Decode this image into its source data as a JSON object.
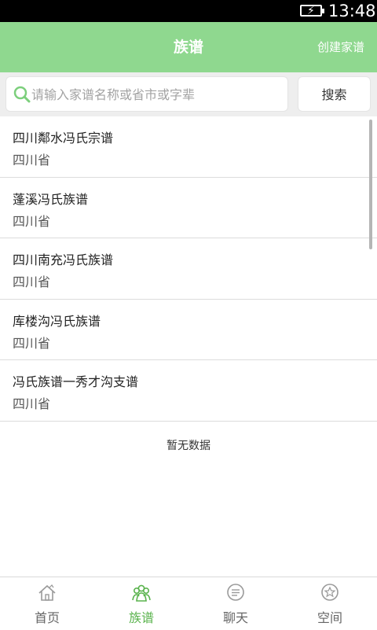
{
  "status_bar": {
    "time": "13:48"
  },
  "header": {
    "title": "族谱",
    "create_label": "创建家谱"
  },
  "search": {
    "placeholder": "请输入家谱名称或省市或字辈",
    "button_label": "搜索"
  },
  "list": {
    "items": [
      {
        "name": "四川鄰水冯氏宗谱",
        "province": "四川省"
      },
      {
        "name": "蓬溪冯氏族谱",
        "province": "四川省"
      },
      {
        "name": "四川南充冯氏族谱",
        "province": "四川省"
      },
      {
        "name": "库楼沟冯氏族谱",
        "province": "四川省"
      },
      {
        "name": "冯氏族谱一秀才沟支谱",
        "province": "四川省"
      }
    ],
    "empty_text": "暂无数据"
  },
  "tabs": [
    {
      "label": "首页",
      "icon": "home-icon"
    },
    {
      "label": "族谱",
      "icon": "family-icon",
      "active": true
    },
    {
      "label": "聊天",
      "icon": "chat-icon"
    },
    {
      "label": "空间",
      "icon": "star-space-icon"
    }
  ],
  "colors": {
    "accent": "#8fd88f",
    "tab_active": "#5ab34d"
  }
}
